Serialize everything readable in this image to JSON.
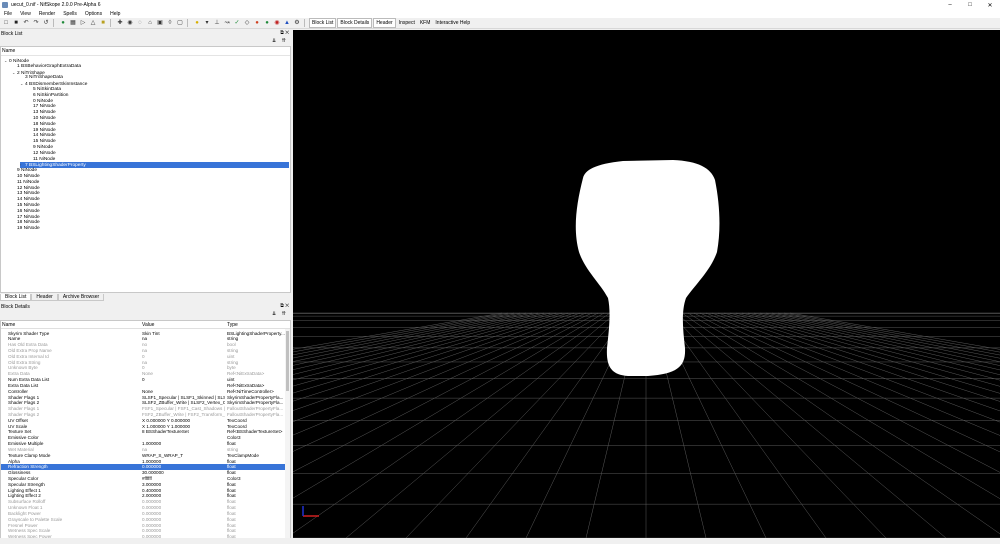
{
  "window": {
    "title": "uecut_0.nif - NifSkope 2.0.0 Pre-Alpha 6"
  },
  "menu": [
    "File",
    "View",
    "Render",
    "Spells",
    "Options",
    "Help"
  ],
  "toolbar": {
    "panel_buttons": [
      "Block List",
      "Block Details",
      "Header",
      "Inspect",
      "KFM",
      "Interactive Help"
    ]
  },
  "block_list": {
    "title": "Block List",
    "column": "Name",
    "rows": [
      {
        "indent": 0,
        "arrow": "v",
        "text": "0 NiNode"
      },
      {
        "indent": 1,
        "arrow": "",
        "text": "1 BSBehaviorGraphExtraData"
      },
      {
        "indent": 1,
        "arrow": "v",
        "text": "2 NiTriShape"
      },
      {
        "indent": 2,
        "arrow": "",
        "text": "3 NiTriShapeData"
      },
      {
        "indent": 2,
        "arrow": "v",
        "text": "4 BSDismemberSkinInstance"
      },
      {
        "indent": 3,
        "arrow": "",
        "text": "5 NiSkinData"
      },
      {
        "indent": 3,
        "arrow": "",
        "text": "6 NiSkinPartition"
      },
      {
        "indent": 3,
        "arrow": "",
        "text": "0 NiNode"
      },
      {
        "indent": 3,
        "arrow": "",
        "text": "17 NiNode"
      },
      {
        "indent": 3,
        "arrow": "",
        "text": "13 NiNode"
      },
      {
        "indent": 3,
        "arrow": "",
        "text": "10 NiNode"
      },
      {
        "indent": 3,
        "arrow": "",
        "text": "18 NiNode"
      },
      {
        "indent": 3,
        "arrow": "",
        "text": "19 NiNode"
      },
      {
        "indent": 3,
        "arrow": "",
        "text": "14 NiNode"
      },
      {
        "indent": 3,
        "arrow": "",
        "text": "15 NiNode"
      },
      {
        "indent": 3,
        "arrow": "",
        "text": "9 NiNode"
      },
      {
        "indent": 3,
        "arrow": "",
        "text": "12 NiNode"
      },
      {
        "indent": 3,
        "arrow": "",
        "text": "11 NiNode"
      },
      {
        "indent": 2,
        "arrow": ">",
        "text": "7 BSLightingShaderProperty",
        "selected": true
      },
      {
        "indent": 1,
        "arrow": "",
        "text": "9 NiNode"
      },
      {
        "indent": 1,
        "arrow": "",
        "text": "10 NiNode"
      },
      {
        "indent": 1,
        "arrow": "",
        "text": "11 NiNode"
      },
      {
        "indent": 1,
        "arrow": "",
        "text": "12 NiNode"
      },
      {
        "indent": 1,
        "arrow": "",
        "text": "13 NiNode"
      },
      {
        "indent": 1,
        "arrow": "",
        "text": "14 NiNode"
      },
      {
        "indent": 1,
        "arrow": "",
        "text": "15 NiNode"
      },
      {
        "indent": 1,
        "arrow": "",
        "text": "16 NiNode"
      },
      {
        "indent": 1,
        "arrow": "",
        "text": "17 NiNode"
      },
      {
        "indent": 1,
        "arrow": "",
        "text": "18 NiNode"
      },
      {
        "indent": 1,
        "arrow": "",
        "text": "19 NiNode"
      }
    ]
  },
  "bottom_tabs": [
    "Block List",
    "Header",
    "Archive Browser"
  ],
  "block_details": {
    "title": "Block Details",
    "columns": [
      "Name",
      "Value",
      "Type"
    ],
    "rows": [
      {
        "name": "Skyrim Shader Type",
        "value": "Skin Tint",
        "type": "BSLightingShaderProperty...",
        "dim": false
      },
      {
        "name": "Name",
        "value": "na",
        "type": "string",
        "dim": false
      },
      {
        "name": "Has Old Extra Data",
        "value": "no",
        "type": "bool",
        "dim": true
      },
      {
        "name": "Old Extra Prop Name",
        "value": "na",
        "type": "string",
        "dim": true
      },
      {
        "name": "Old Extra Internal Id",
        "value": "0",
        "type": "uint",
        "dim": true
      },
      {
        "name": "Old Extra String",
        "value": "na",
        "type": "string",
        "dim": true
      },
      {
        "name": "Unknown Byte",
        "value": "0",
        "type": "byte",
        "dim": true
      },
      {
        "name": "Extra Data",
        "value": "None",
        "type": "Ref<NiExtraData>",
        "dim": true
      },
      {
        "name": "Num Extra Data List",
        "value": "0",
        "type": "uint",
        "dim": false
      },
      {
        "name": "Extra Data List",
        "value": "",
        "type": "Ref<NiExtraData>",
        "dim": false
      },
      {
        "name": "Controller",
        "value": "None",
        "type": "Ref<NiTimeController>",
        "dim": false
      },
      {
        "name": "Shader Flags 1",
        "value": "SLSF1_Specular | SLSF1_Skinned | SLSF...",
        "type": "SkyrimShaderPropertyFla...",
        "dim": false
      },
      {
        "name": "Shader Flags 2",
        "value": "SLSF2_ZBuffer_Write | SLSF2_Vertex_C...",
        "type": "SkyrimShaderPropertyFla...",
        "dim": false
      },
      {
        "name": "Shader Flags 1",
        "value": "FSF1_Specular | FSF1_Cast_Shadows | ...",
        "type": "FalloutShaderPropertyFla...",
        "dim": true
      },
      {
        "name": "Shader Flags 2",
        "value": "FSF2_ZBuffer_Write | FSF2_Transform_...",
        "type": "FalloutShaderPropertyFla...",
        "dim": true
      },
      {
        "name": "UV Offset",
        "value": "X 0.000000 Y 0.000000",
        "type": "TexCoord",
        "dim": false
      },
      {
        "name": "UV Scale",
        "value": "X 1.000000 Y 1.000000",
        "type": "TexCoord",
        "dim": false
      },
      {
        "name": "Texture Set",
        "value": "8 BSShaderTextureSet",
        "type": "Ref<BSShaderTextureSet>",
        "dim": false
      },
      {
        "name": "Emissive Color",
        "value": "",
        "type": "Color3",
        "dim": false,
        "swatch": true
      },
      {
        "name": "Emissive Multiple",
        "value": "1.000000",
        "type": "float",
        "dim": false
      },
      {
        "name": "Wet Material",
        "value": "na",
        "type": "string",
        "dim": true
      },
      {
        "name": "Texture Clamp Mode",
        "value": "WRAP_S_WRAP_T",
        "type": "TexClampMode",
        "dim": false
      },
      {
        "name": "Alpha",
        "value": "1.000000",
        "type": "float",
        "dim": false
      },
      {
        "name": "Refraction Strength",
        "value": "0.000000",
        "type": "float",
        "dim": false,
        "selected": true
      },
      {
        "name": "Glossiness",
        "value": "30.000000",
        "type": "float",
        "dim": false
      },
      {
        "name": "Specular Color",
        "value": "#ffffff",
        "type": "Color3",
        "dim": false
      },
      {
        "name": "Specular Strength",
        "value": "3.000000",
        "type": "float",
        "dim": false
      },
      {
        "name": "Lighting Effect 1",
        "value": "0.400000",
        "type": "float",
        "dim": false
      },
      {
        "name": "Lighting Effect 2",
        "value": "2.000000",
        "type": "float",
        "dim": false
      },
      {
        "name": "Subsurface Rolloff",
        "value": "0.000000",
        "type": "float",
        "dim": true
      },
      {
        "name": "Unknown Float 1",
        "value": "0.000000",
        "type": "float",
        "dim": true
      },
      {
        "name": "Backlight Power",
        "value": "0.000000",
        "type": "float",
        "dim": true
      },
      {
        "name": "Grayscale to Palette Scale",
        "value": "0.000000",
        "type": "float",
        "dim": true
      },
      {
        "name": "Fresnel Power",
        "value": "0.000000",
        "type": "float",
        "dim": true
      },
      {
        "name": "Wetness Spec Scale",
        "value": "0.000000",
        "type": "float",
        "dim": true
      },
      {
        "name": "Wetness Spec Power",
        "value": "0.000000",
        "type": "float",
        "dim": true
      }
    ]
  },
  "colors": {
    "selection": "#3874d8",
    "viewport_bg": "#000000",
    "grid_line": "#5a5a5a",
    "mesh": "#ffffff",
    "axis_x": "#d02020",
    "axis_y": "#2030d0"
  },
  "icons": [
    "new-file-icon",
    "open-icon",
    "save-icon",
    "undo-icon",
    "redo-icon",
    "load-view-icon",
    "perspective-icon",
    "select-icon",
    "walk-icon",
    "light-icon",
    "wireframe-icon",
    "normals-icon",
    "hidden-icon",
    "skeleton-icon",
    "bounds-icon",
    "vertex-color-icon",
    "texture-icon",
    "shader-icon",
    "marker-icon",
    "paint-icon",
    "globe-icon"
  ]
}
